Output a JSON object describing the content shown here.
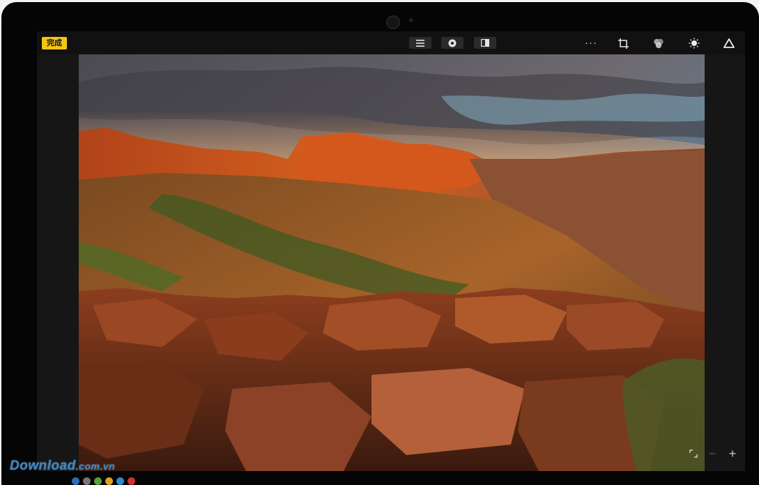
{
  "toolbar": {
    "done_label": "完成",
    "center_icons": [
      "list-icon",
      "filter-circle-icon",
      "compare-split-icon"
    ],
    "right_icons": [
      "more-icon",
      "crop-icon",
      "color-adjust-icon",
      "light-adjust-icon",
      "presets-triangle-icon"
    ],
    "more_label": "···"
  },
  "zoom": {
    "minus_label": "−",
    "plus_label": "+"
  },
  "watermark": {
    "brand": "Download",
    "suffix": ".com.vn",
    "dot_colors": [
      "#2e6db3",
      "#777777",
      "#5aa03a",
      "#e0a020",
      "#2a8ad0",
      "#d03030"
    ]
  },
  "colors": {
    "accent": "#f3c613",
    "background": "#111111"
  }
}
